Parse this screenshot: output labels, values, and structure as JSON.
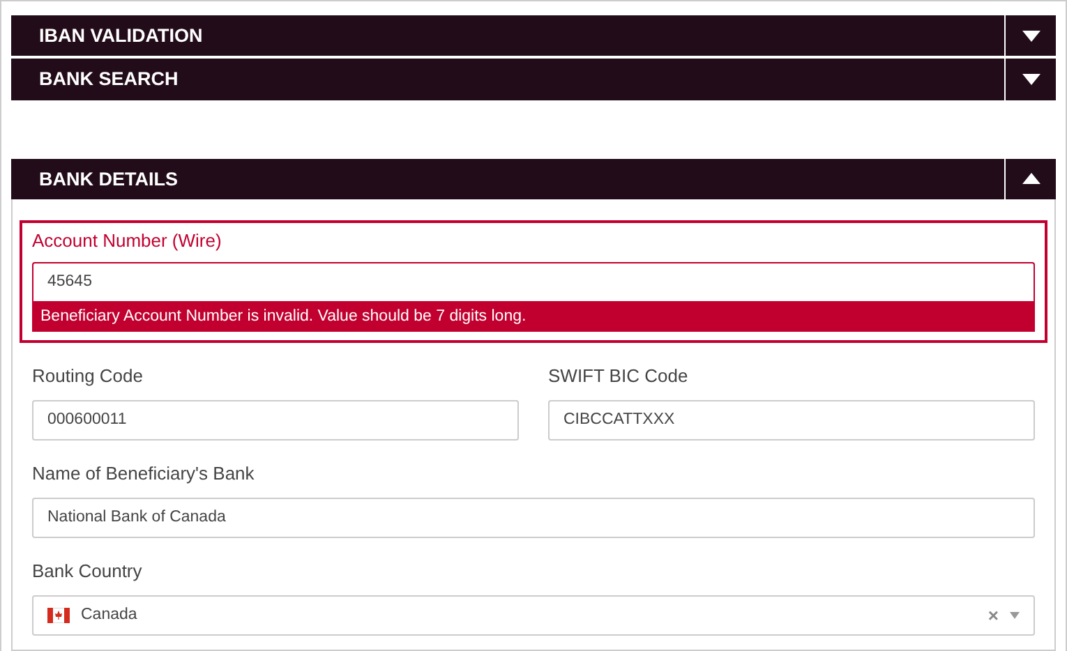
{
  "sections": [
    {
      "title": "IBAN VALIDATION",
      "expanded": false
    },
    {
      "title": "BANK SEARCH",
      "expanded": false
    },
    {
      "title": "BANK DETAILS",
      "expanded": true
    }
  ],
  "rows": [
    [
      {
        "kind": "text",
        "label": "Account Number (Wire)",
        "value": "45645",
        "error": "Beneficiary Account Number is invalid. Value should be 7 digits long."
      }
    ],
    [
      {
        "kind": "text",
        "label": "Routing Code",
        "value": "000600011"
      },
      {
        "kind": "text",
        "label": "SWIFT BIC Code",
        "value": "CIBCCATTXXX"
      }
    ],
    [
      {
        "kind": "text",
        "label": "Name of Beneficiary's Bank",
        "value": "National Bank of Canada"
      }
    ],
    [
      {
        "kind": "select",
        "label": "Bank Country",
        "value": "Canada",
        "clear": "×"
      }
    ]
  ]
}
